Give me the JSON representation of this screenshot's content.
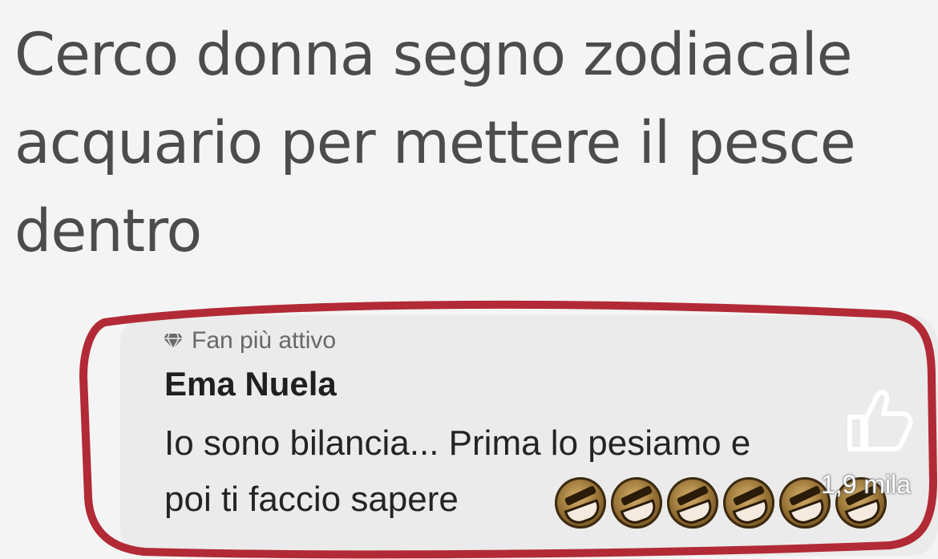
{
  "post": {
    "text": "Cerco donna segno zodiacale\nacquario per mettere il pesce\ndentro"
  },
  "comment": {
    "badge_icon": "diamond-badge-icon",
    "badge_label": "Fan più attivo",
    "author": "Ema Nuela",
    "line1": "Io sono bilancia... Prima lo pesiamo e",
    "line2": "poi ti faccio sapere",
    "emoji_icon": "rolling-on-floor-laughing-emoji",
    "emoji_count": 6
  },
  "overlay": {
    "like_icon": "thumbs-up-icon",
    "like_count": "1,9 mila"
  },
  "colors": {
    "background": "#f4f4f4",
    "bubble": "#ebebeb",
    "highlight_outline": "#b22a35"
  }
}
